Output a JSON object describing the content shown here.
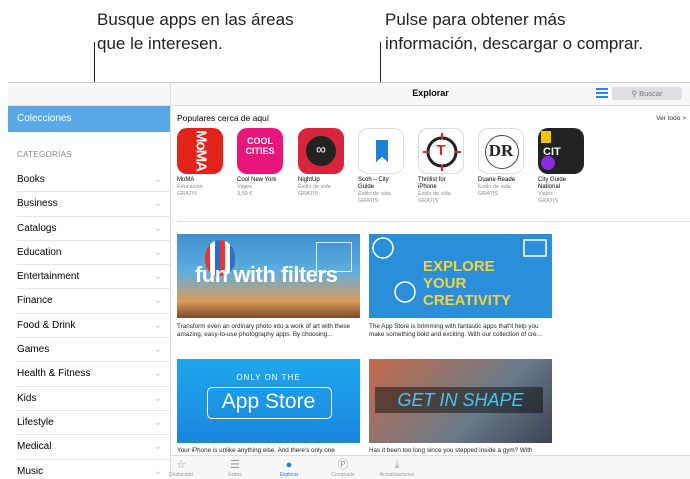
{
  "callouts": {
    "left": [
      "Busque apps en las áreas",
      "que le interesen."
    ],
    "right": [
      "Pulse para obtener más",
      "información, descargar o comprar."
    ]
  },
  "navbar": {
    "title": "Explorar",
    "search": "Buscar"
  },
  "sidebar": {
    "selected": "Colecciones",
    "categories_header": "CATEGORÍAS",
    "items": [
      "Books",
      "Business",
      "Catalogs",
      "Education",
      "Entertainment",
      "Finance",
      "Food & Drink",
      "Games",
      "Health & Fitness",
      "Kids",
      "Lifestyle",
      "Medical",
      "Music"
    ]
  },
  "popular": {
    "title": "Populares cerca de aquí",
    "see_all": "Ver todo >",
    "apps": [
      {
        "name": "MoMA",
        "line2": "",
        "cat": "Educación",
        "price": "GRATIS",
        "icon_text": "MoMA",
        "color": "#e2231a"
      },
      {
        "name": "Cool New York",
        "line2": "",
        "cat": "Viajes",
        "price": "3,59 €",
        "icon_text": "COOL CITIES",
        "color": "#e8167c"
      },
      {
        "name": "NightUp",
        "line2": "",
        "cat": "Estilo de vida",
        "price": "GRATIS",
        "icon_text": "∞",
        "color": "#d7253b"
      },
      {
        "name": "Scoh – City",
        "line2": "Guide",
        "cat": "Estilo de vida",
        "price": "GRATIS",
        "icon_text": "",
        "color": "#ffffff"
      },
      {
        "name": "Thrillist for",
        "line2": "iPhone",
        "cat": "Estilo de vida",
        "price": "GRATIS",
        "icon_text": "T",
        "color": "#ffffff"
      },
      {
        "name": "Duane Reade",
        "line2": "",
        "cat": "Estilo de vida",
        "price": "GRATIS",
        "icon_text": "DR",
        "color": "#ffffff"
      },
      {
        "name": "City Guide",
        "line2": "National",
        "cat": "Viajes",
        "price": "GRATIS",
        "icon_text": "CIT",
        "color": "#222222"
      }
    ]
  },
  "banners": [
    {
      "headline": "fun with filters",
      "caption1": "Transform even an ordinary photo into a work of art with these",
      "caption2": "amazing, easy-to-use photography apps. By choosing..."
    },
    {
      "headline": "EXPLORE YOUR CREATIVITY",
      "caption1": "The App Store is brimming with fantastic apps that'll help you",
      "caption2": "make something bold and exciting. With our collection of cre..."
    },
    {
      "headline": "App Store",
      "top": "ONLY ON THE",
      "caption1": "Your iPhone is unlike anything else. And there's only one",
      "caption2": ""
    },
    {
      "headline": "GET IN SHAPE",
      "caption1": "Has it been too long since you stepped inside a gym? With",
      "caption2": ""
    }
  ],
  "tabs": [
    "Destacado",
    "Éxitos",
    "Explorar",
    "Comprado",
    "Actualizaciones"
  ]
}
